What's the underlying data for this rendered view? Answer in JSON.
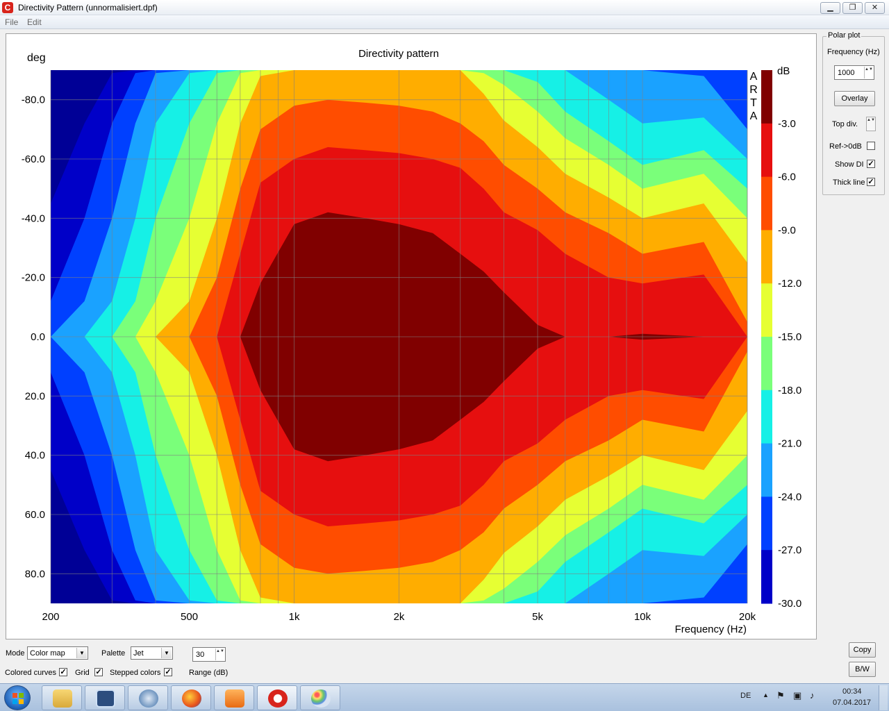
{
  "window": {
    "title": "Directivity Pattern  (unnormalisiert.dpf)",
    "app_icon_glyph": "C",
    "minimize_glyph": "▁",
    "maximize_glyph": "❐",
    "close_glyph": "✕"
  },
  "menu": {
    "file": "File",
    "edit": "Edit"
  },
  "chart_data": {
    "type": "heatmap",
    "title": "Directivity pattern",
    "xlabel": "Frequency (Hz)",
    "ylabel": "deg",
    "x_scale": "log",
    "xlim": [
      200,
      20000
    ],
    "ylim": [
      -90,
      90
    ],
    "x_ticks": [
      200,
      500,
      1000,
      2000,
      5000,
      10000,
      20000
    ],
    "x_tick_labels": [
      "200",
      "500",
      "1k",
      "2k",
      "5k",
      "10k",
      "20k"
    ],
    "y_ticks": [
      -80,
      -60,
      -40,
      -20,
      0,
      20,
      40,
      60,
      80
    ],
    "y_tick_labels": [
      "-80.0",
      "-60.0",
      "-40.0",
      "-20.0",
      "0.0",
      "20.0",
      "40.0",
      "60.0",
      "80.0"
    ],
    "grid": true,
    "watermark": "ARTA",
    "colorbar": {
      "unit": "dB",
      "range": [
        -30,
        0
      ],
      "tick_labels": [
        "-3.0",
        "-6.0",
        "-9.0",
        "-12.0",
        "-15.0",
        "-18.0",
        "-21.0",
        "-24.0",
        "-27.0",
        "-30.0"
      ],
      "colors": [
        "#800000",
        "#e60f0f",
        "#ff4d00",
        "#ffad00",
        "#e6ff33",
        "#7aff7a",
        "#16f0e6",
        "#1aa2ff",
        "#0040ff",
        "#0000c8",
        "#000096"
      ]
    },
    "contours": [
      {
        "level": -30,
        "half_width_deg": [
          45,
          72,
          89,
          90,
          90,
          90,
          90,
          90,
          90,
          90,
          90,
          90,
          90,
          90,
          90,
          90,
          90,
          90,
          90,
          90,
          90,
          90,
          90
        ]
      },
      {
        "level": -27,
        "half_width_deg": [
          12,
          40,
          72,
          89,
          90,
          90,
          90,
          90,
          90,
          90,
          90,
          90,
          90,
          90,
          90,
          90,
          90,
          90,
          90,
          90,
          90,
          90,
          90
        ]
      },
      {
        "level": -24,
        "half_width_deg": [
          0,
          12,
          40,
          72,
          89,
          90,
          90,
          90,
          90,
          90,
          90,
          90,
          90,
          90,
          90,
          90,
          90,
          90,
          90,
          90,
          90,
          88,
          70
        ]
      },
      {
        "level": -21,
        "half_width_deg": [
          0,
          0,
          12,
          40,
          72,
          89,
          90,
          90,
          90,
          90,
          90,
          90,
          90,
          90,
          90,
          90,
          90,
          90,
          90,
          80,
          72,
          74,
          60
        ]
      },
      {
        "level": -18,
        "half_width_deg": [
          0,
          0,
          0,
          12,
          40,
          72,
          89,
          90,
          90,
          90,
          90,
          90,
          90,
          90,
          90,
          90,
          90,
          86,
          76,
          66,
          58,
          63,
          50
        ]
      },
      {
        "level": -15,
        "half_width_deg": [
          0,
          0,
          0,
          0,
          12,
          40,
          72,
          89,
          90,
          90,
          90,
          90,
          90,
          90,
          90,
          89,
          85,
          76,
          67,
          58,
          50,
          55,
          40
        ]
      },
      {
        "level": -12,
        "half_width_deg": [
          0,
          0,
          0,
          0,
          0,
          12,
          40,
          72,
          88,
          90,
          90,
          90,
          90,
          90,
          90,
          82,
          73,
          64,
          55,
          47,
          40,
          45,
          25
        ]
      },
      {
        "level": -9,
        "half_width_deg": [
          0,
          0,
          0,
          0,
          0,
          0,
          20,
          50,
          70,
          78,
          80,
          79,
          78,
          76,
          72,
          66,
          58,
          50,
          42,
          35,
          28,
          32,
          5
        ]
      },
      {
        "level": -6,
        "half_width_deg": [
          0,
          0,
          0,
          0,
          0,
          0,
          0,
          28,
          52,
          60,
          64,
          63,
          62,
          60,
          57,
          50,
          42,
          36,
          28,
          20,
          18,
          21,
          0
        ]
      },
      {
        "level": -3,
        "half_width_deg": [
          0,
          0,
          0,
          0,
          0,
          0,
          0,
          0,
          18,
          38,
          42,
          40,
          38,
          35,
          28,
          22,
          15,
          4,
          0,
          0,
          1,
          0,
          0
        ]
      }
    ],
    "contour_freqs": [
      200,
      250,
      300,
      350,
      400,
      500,
      600,
      700,
      800,
      1000,
      1250,
      1600,
      2000,
      2500,
      3000,
      3500,
      4000,
      5000,
      6000,
      8000,
      10000,
      15000,
      20000
    ]
  },
  "side_panel": {
    "group_title": "Polar plot",
    "frequency_label": "Frequency (Hz)",
    "frequency_value": "1000",
    "overlay_button": "Overlay",
    "top_div_label": "Top div.",
    "ref_label": "Ref->0dB",
    "ref_checked": false,
    "show_di_label": "Show DI",
    "show_di_checked": true,
    "thick_line_label": "Thick line",
    "thick_line_checked": true,
    "check_glyph": "✓",
    "spin_glyph": "▲▼"
  },
  "bottom_panel": {
    "mode_label": "Mode",
    "mode_value": "Color map",
    "palette_label": "Palette",
    "palette_value": "Jet",
    "range_value": "30",
    "range_label": "Range (dB)",
    "colored_curves_label": "Colored curves",
    "colored_curves_checked": true,
    "grid_label": "Grid",
    "grid_checked": true,
    "stepped_colors_label": "Stepped colors",
    "stepped_colors_checked": true,
    "copy_button": "Copy",
    "bw_button": "B/W",
    "drop_glyph": "▼"
  },
  "taskbar": {
    "language": "DE",
    "time": "00:34",
    "date": "07.04.2017",
    "apps": [
      "explorer-icon",
      "arta-steps-icon",
      "thunderbird-icon",
      "firefox-icon",
      "media-player-icon",
      "arta-icon",
      "paint-icon"
    ]
  }
}
